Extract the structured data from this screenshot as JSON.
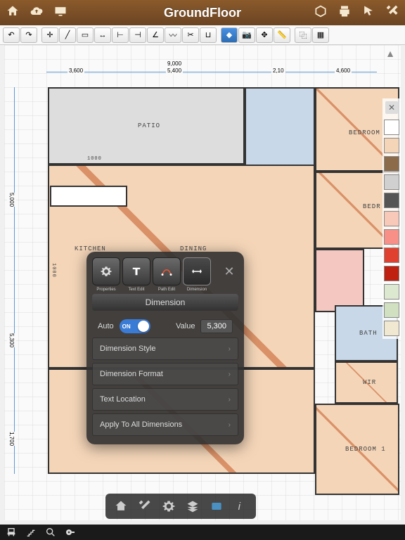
{
  "titlebar": {
    "title": "GroundFloor"
  },
  "dimensions": {
    "top": [
      {
        "value": "3,600"
      },
      {
        "value": "9,000"
      },
      {
        "value": "5,400"
      },
      {
        "value": "2,10"
      },
      {
        "value": "4,600"
      }
    ],
    "left": [
      {
        "value": "5,000"
      },
      {
        "value": "5,300"
      },
      {
        "value": "1,700"
      }
    ],
    "inner": [
      {
        "value": "1000"
      },
      {
        "value": "1000"
      }
    ]
  },
  "rooms": {
    "patio": "PATIO",
    "kitchen": "KITCHEN",
    "dining": "DINING",
    "bedroom1": "BEDROOM",
    "bedroom2": "BEDR",
    "bedroom3": "BEDROOM 1",
    "bath": "BATH",
    "wir": "WIR"
  },
  "swatches": [
    "#ffffff",
    "#f4d5b8",
    "#8b6b4a",
    "#d0d0d0",
    "#555555",
    "#f8c8b8",
    "#f89088",
    "#e04030",
    "#c02010",
    "#dde8d0",
    "#d0e0c0",
    "#f0e8d0"
  ],
  "popup": {
    "tabs": {
      "properties": "Properties",
      "textedit": "Text Edit",
      "pathedit": "Path Edit",
      "dimension": "Dimension"
    },
    "title": "Dimension",
    "auto_label": "Auto",
    "toggle_state": "ON",
    "value_label": "Value",
    "value": "5,300",
    "items": [
      "Dimension Style",
      "Dimension Format",
      "Text Location",
      "Apply To All Dimensions"
    ]
  }
}
